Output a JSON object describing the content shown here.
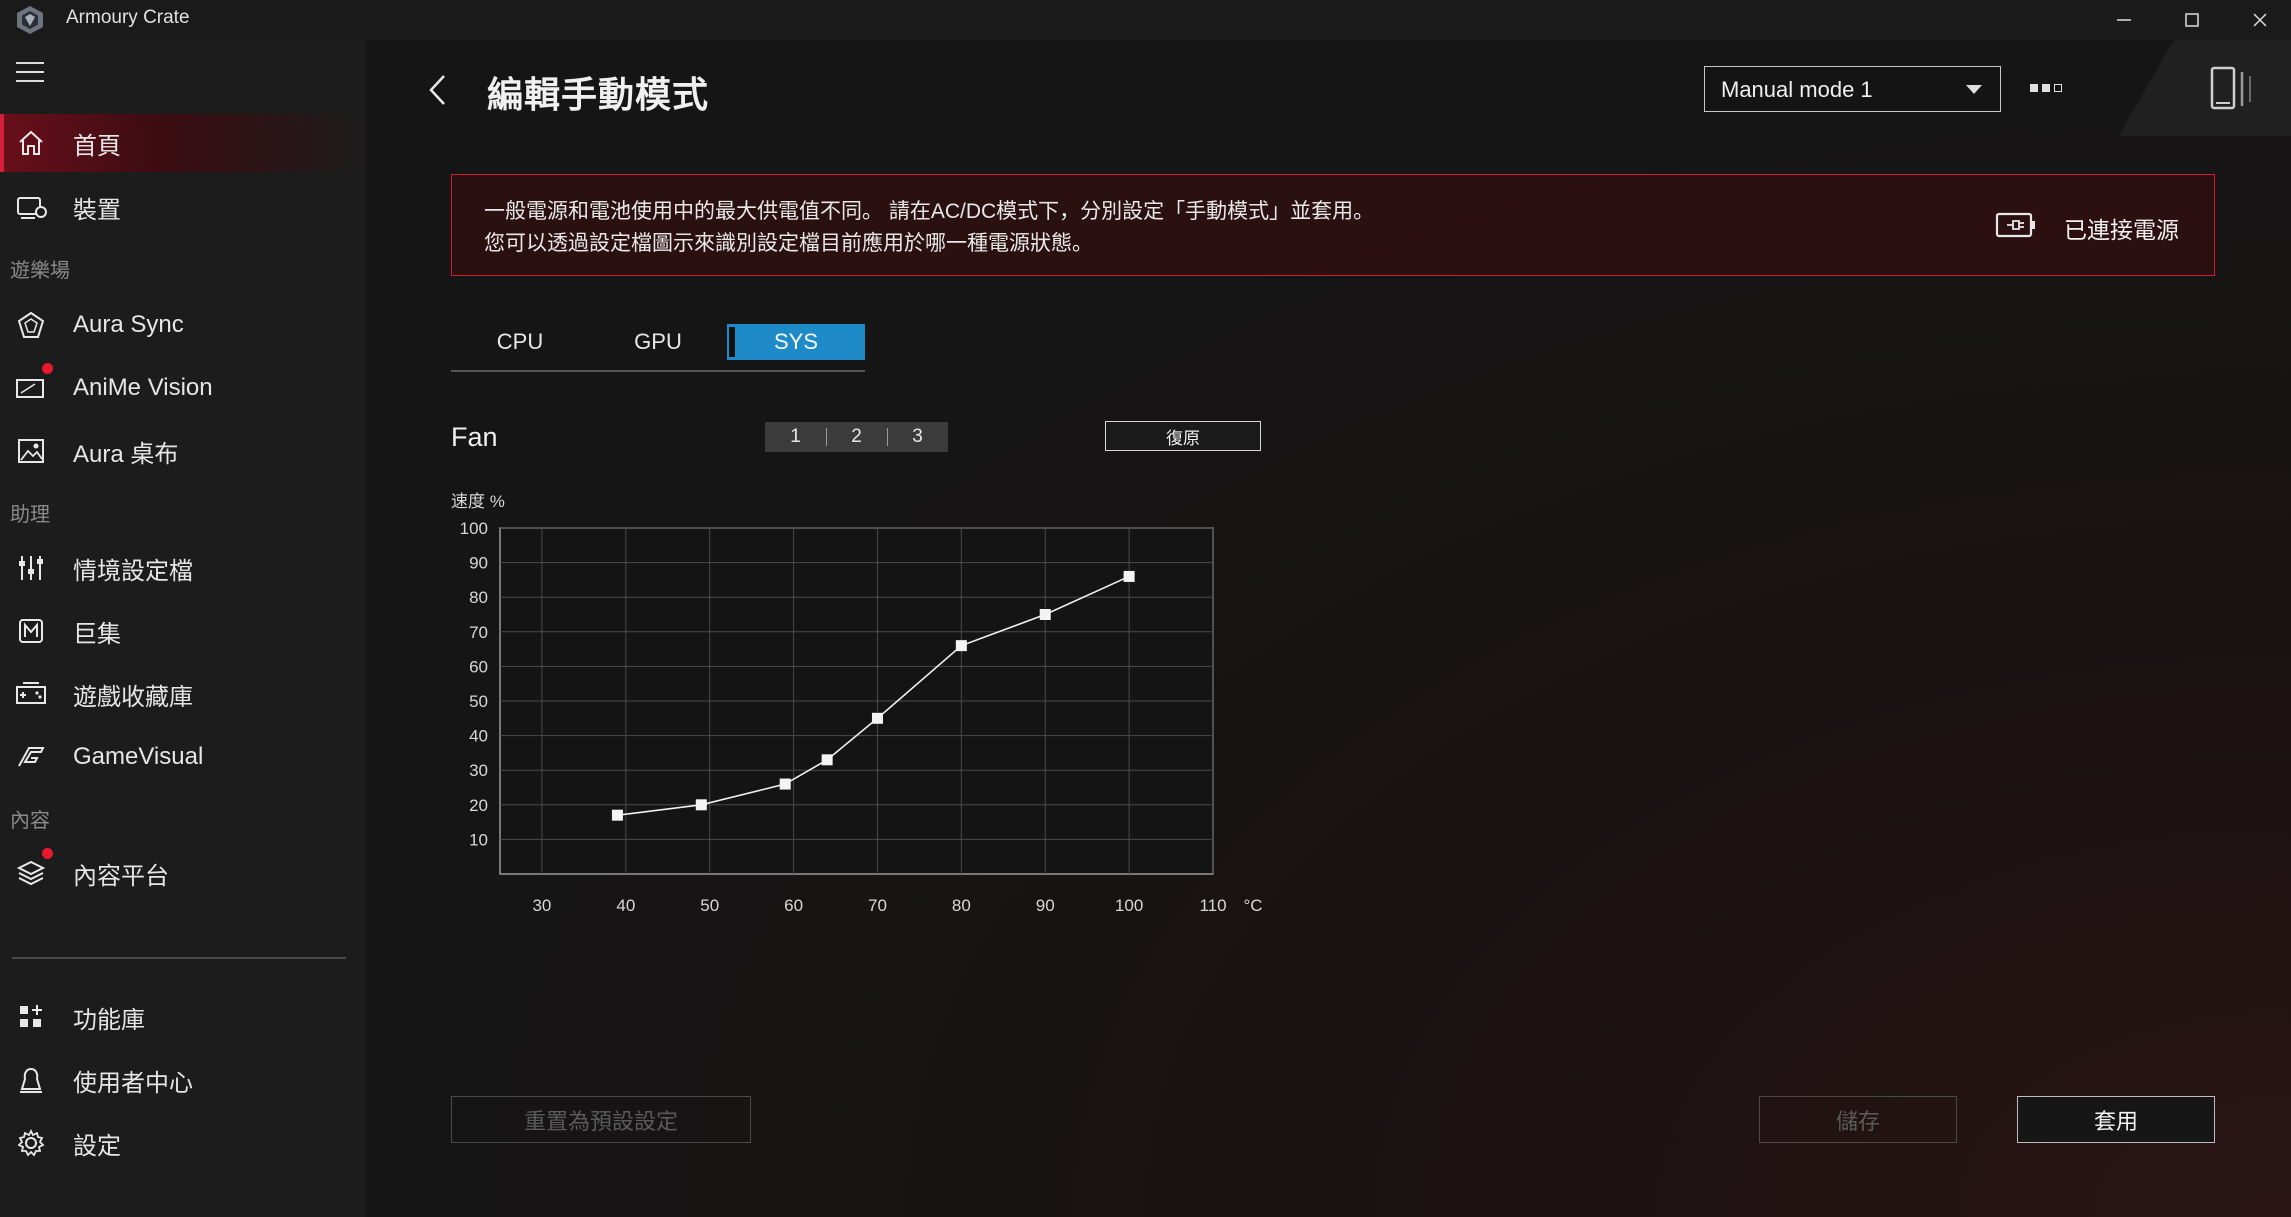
{
  "window": {
    "title": "Armoury Crate"
  },
  "sidebar": {
    "items": [
      {
        "label": "首頁",
        "icon": "home-icon"
      },
      {
        "label": "裝置",
        "icon": "device-icon"
      },
      {
        "label": "Aura Sync",
        "icon": "aura-sync-icon"
      },
      {
        "label": "AniMe Vision",
        "icon": "anime-vision-icon"
      },
      {
        "label": "Aura 桌布",
        "icon": "wallpaper-icon"
      },
      {
        "label": "情境設定檔",
        "icon": "sliders-icon"
      },
      {
        "label": "巨集",
        "icon": "macro-icon"
      },
      {
        "label": "遊戲收藏庫",
        "icon": "game-library-icon"
      },
      {
        "label": "GameVisual",
        "icon": "gamevisual-icon"
      },
      {
        "label": "內容平台",
        "icon": "layers-icon"
      },
      {
        "label": "功能庫",
        "icon": "feature-library-icon"
      },
      {
        "label": "使用者中心",
        "icon": "user-center-icon"
      },
      {
        "label": "設定",
        "icon": "gear-icon"
      }
    ],
    "sections": [
      "遊樂場",
      "助理",
      "內容"
    ]
  },
  "header": {
    "title": "編輯手動模式",
    "mode_select": "Manual mode 1"
  },
  "notice": {
    "line1": "一般電源和電池使用中的最大供電值不同。 請在AC/DC模式下，分別設定「手動模式」並套用。",
    "line2": "您可以透過設定檔圖示來識別設定檔目前應用於哪一種電源狀態。",
    "status": "已連接電源",
    "border_color": "#c8202e"
  },
  "tabs": [
    {
      "label": "CPU",
      "active": false
    },
    {
      "label": "GPU",
      "active": false
    },
    {
      "label": "SYS",
      "active": true
    }
  ],
  "fan": {
    "title": "Fan",
    "segments": [
      "1",
      "2",
      "3"
    ],
    "reset_label": "復原",
    "y_axis_title": "速度 %"
  },
  "chart_data": {
    "type": "line",
    "x_unit": "°C",
    "x_ticks": [
      30,
      40,
      50,
      60,
      70,
      80,
      90,
      100,
      110
    ],
    "y_ticks": [
      10,
      20,
      30,
      40,
      50,
      60,
      70,
      80,
      90,
      100
    ],
    "xlim": [
      25,
      110
    ],
    "ylim": [
      0,
      100
    ],
    "grid": true,
    "x": [
      39,
      49,
      59,
      64,
      70,
      80,
      90,
      100
    ],
    "y": [
      17,
      20,
      26,
      33,
      45,
      66,
      75,
      86
    ]
  },
  "footer": {
    "reset_default": "重置為預設設定",
    "save": "儲存",
    "apply": "套用"
  }
}
